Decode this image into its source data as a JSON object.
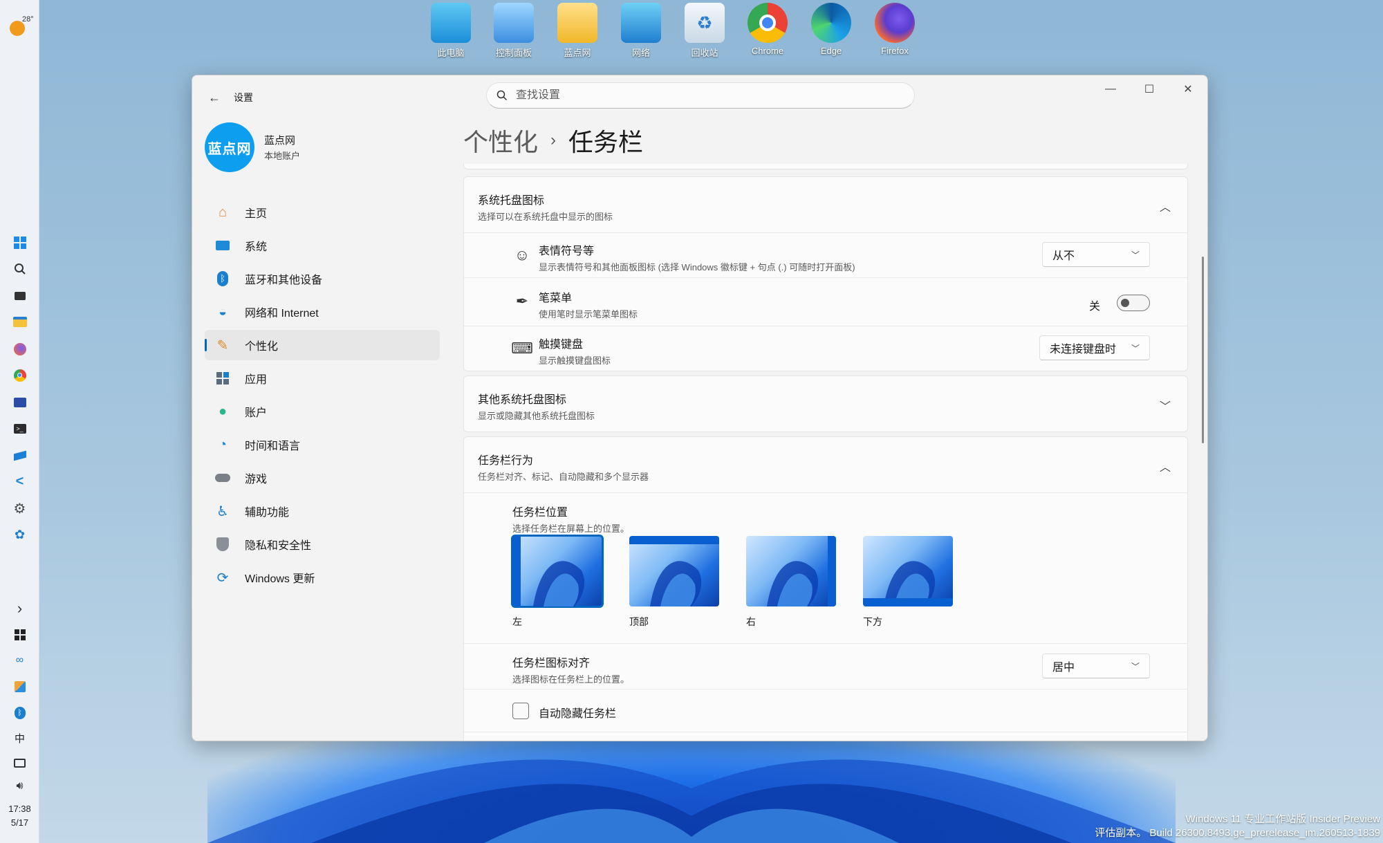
{
  "desktop": {
    "icons": [
      {
        "name": "thispc",
        "label": "此电脑"
      },
      {
        "name": "controlpanel",
        "label": "控制面板"
      },
      {
        "name": "userfolder",
        "label": "蓝点网"
      },
      {
        "name": "network",
        "label": "网络"
      },
      {
        "name": "recyclebin",
        "label": "回收站"
      },
      {
        "name": "chrome",
        "label": "Chrome"
      },
      {
        "name": "edge",
        "label": "Edge"
      },
      {
        "name": "firefox",
        "label": "Firefox"
      }
    ],
    "watermark": {
      "line1": "Windows 11 专业工作站版 Insider Preview",
      "line2": "评估副本。 Build 26300.8493.ge_prerelease_im.260513-1839"
    }
  },
  "taskbar": {
    "weather_temp": "28°",
    "clock_time": "17:38",
    "clock_date": "5/17",
    "ime": "中",
    "expand_glyph": "›"
  },
  "window": {
    "title": "设置",
    "back_glyph": "←",
    "controls": {
      "minimize": "—",
      "maximize": "☐",
      "close": "✕"
    },
    "search": {
      "placeholder": "查找设置"
    },
    "account": {
      "avatar_text": "蓝点网",
      "name": "蓝点网",
      "type": "本地账户"
    },
    "nav": [
      {
        "label": "主页",
        "icon": "home-icon"
      },
      {
        "label": "系统",
        "icon": "system-icon"
      },
      {
        "label": "蓝牙和其他设备",
        "icon": "bluetooth-icon"
      },
      {
        "label": "网络和 Internet",
        "icon": "wifi-icon"
      },
      {
        "label": "个性化",
        "icon": "brush-icon",
        "active": true
      },
      {
        "label": "应用",
        "icon": "apps-icon"
      },
      {
        "label": "账户",
        "icon": "person-icon"
      },
      {
        "label": "时间和语言",
        "icon": "globe-icon"
      },
      {
        "label": "游戏",
        "icon": "gamepad-icon"
      },
      {
        "label": "辅助功能",
        "icon": "accessibility-icon"
      },
      {
        "label": "隐私和安全性",
        "icon": "shield-icon"
      },
      {
        "label": "Windows 更新",
        "icon": "update-icon"
      }
    ],
    "breadcrumb": {
      "parent": "个性化",
      "sep": "›",
      "current": "任务栏"
    },
    "tray": {
      "title": "系统托盘图标",
      "subtitle": "选择可以在系统托盘中显示的图标",
      "emoji": {
        "title": "表情符号等",
        "subtitle": "显示表情符号和其他面板图标 (选择 Windows 徽标键 + 句点 (.) 可随时打开面板)",
        "value": "从不"
      },
      "pen": {
        "title": "笔菜单",
        "subtitle": "使用笔时显示笔菜单图标",
        "toggle_label": "关",
        "on": false
      },
      "touch_keyboard": {
        "title": "触摸键盘",
        "subtitle": "显示触摸键盘图标",
        "value": "未连接键盘时"
      }
    },
    "other_tray": {
      "title": "其他系统托盘图标",
      "subtitle": "显示或隐藏其他系统托盘图标"
    },
    "behavior": {
      "title": "任务栏行为",
      "subtitle": "任务栏对齐、标记、自动隐藏和多个显示器",
      "position": {
        "title": "任务栏位置",
        "subtitle": "选择任务栏在屏幕上的位置。",
        "options": [
          {
            "label": "左",
            "bar": "left",
            "selected": true
          },
          {
            "label": "顶部",
            "bar": "top"
          },
          {
            "label": "右",
            "bar": "right"
          },
          {
            "label": "下方",
            "bar": "bottom"
          }
        ]
      },
      "alignment": {
        "title": "任务栏图标对齐",
        "subtitle": "选择图标在任务栏上的位置。",
        "value": "居中"
      },
      "autohide": {
        "label": "自动隐藏任务栏",
        "checked": false
      }
    }
  }
}
